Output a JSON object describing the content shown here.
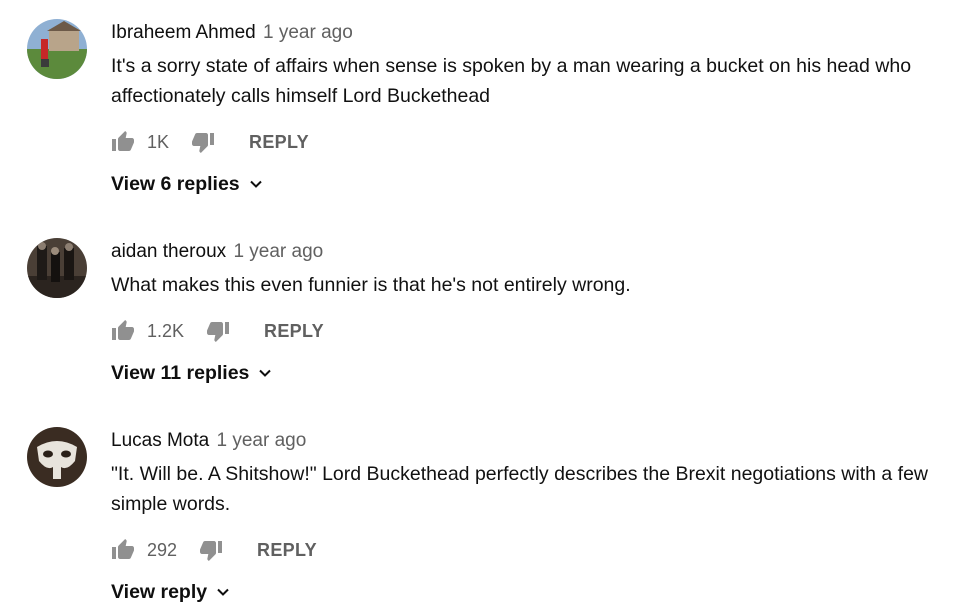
{
  "comments": [
    {
      "author": "Ibraheem Ahmed",
      "time": "1 year ago",
      "text": "It's a sorry state of affairs when sense is spoken by a man wearing a bucket on his head who affectionately calls himself Lord Buckethead",
      "likes": "1K",
      "reply_label": "REPLY",
      "replies_label": "View 6 replies"
    },
    {
      "author": "aidan theroux",
      "time": "1 year ago",
      "text": "What makes this even funnier is that he's not entirely wrong.",
      "likes": "1.2K",
      "reply_label": "REPLY",
      "replies_label": "View 11 replies"
    },
    {
      "author": "Lucas Mota",
      "time": "1 year ago",
      "text": "\"It. Will be. A Shitshow!\" Lord Buckethead perfectly describes the Brexit negotiations with a few simple words.",
      "likes": "292",
      "reply_label": "REPLY",
      "replies_label": "View reply"
    }
  ],
  "icons": {
    "like": "thumb-up-icon",
    "dislike": "thumb-down-icon",
    "expand": "chevron-down-icon"
  },
  "colors": {
    "text": "#0f0f0f",
    "secondary": "#606060",
    "icon": "#909090"
  }
}
